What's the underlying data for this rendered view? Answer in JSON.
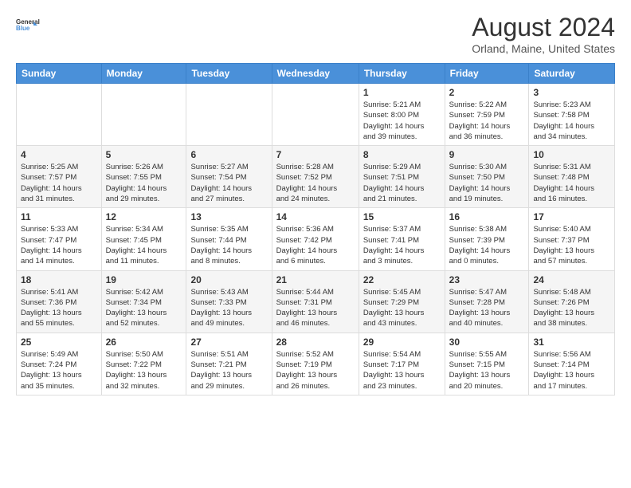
{
  "header": {
    "logo_line1": "General",
    "logo_line2": "Blue",
    "month_title": "August 2024",
    "location": "Orland, Maine, United States"
  },
  "weekdays": [
    "Sunday",
    "Monday",
    "Tuesday",
    "Wednesday",
    "Thursday",
    "Friday",
    "Saturday"
  ],
  "weeks": [
    [
      {
        "day": "",
        "info": ""
      },
      {
        "day": "",
        "info": ""
      },
      {
        "day": "",
        "info": ""
      },
      {
        "day": "",
        "info": ""
      },
      {
        "day": "1",
        "info": "Sunrise: 5:21 AM\nSunset: 8:00 PM\nDaylight: 14 hours\nand 39 minutes."
      },
      {
        "day": "2",
        "info": "Sunrise: 5:22 AM\nSunset: 7:59 PM\nDaylight: 14 hours\nand 36 minutes."
      },
      {
        "day": "3",
        "info": "Sunrise: 5:23 AM\nSunset: 7:58 PM\nDaylight: 14 hours\nand 34 minutes."
      }
    ],
    [
      {
        "day": "4",
        "info": "Sunrise: 5:25 AM\nSunset: 7:57 PM\nDaylight: 14 hours\nand 31 minutes."
      },
      {
        "day": "5",
        "info": "Sunrise: 5:26 AM\nSunset: 7:55 PM\nDaylight: 14 hours\nand 29 minutes."
      },
      {
        "day": "6",
        "info": "Sunrise: 5:27 AM\nSunset: 7:54 PM\nDaylight: 14 hours\nand 27 minutes."
      },
      {
        "day": "7",
        "info": "Sunrise: 5:28 AM\nSunset: 7:52 PM\nDaylight: 14 hours\nand 24 minutes."
      },
      {
        "day": "8",
        "info": "Sunrise: 5:29 AM\nSunset: 7:51 PM\nDaylight: 14 hours\nand 21 minutes."
      },
      {
        "day": "9",
        "info": "Sunrise: 5:30 AM\nSunset: 7:50 PM\nDaylight: 14 hours\nand 19 minutes."
      },
      {
        "day": "10",
        "info": "Sunrise: 5:31 AM\nSunset: 7:48 PM\nDaylight: 14 hours\nand 16 minutes."
      }
    ],
    [
      {
        "day": "11",
        "info": "Sunrise: 5:33 AM\nSunset: 7:47 PM\nDaylight: 14 hours\nand 14 minutes."
      },
      {
        "day": "12",
        "info": "Sunrise: 5:34 AM\nSunset: 7:45 PM\nDaylight: 14 hours\nand 11 minutes."
      },
      {
        "day": "13",
        "info": "Sunrise: 5:35 AM\nSunset: 7:44 PM\nDaylight: 14 hours\nand 8 minutes."
      },
      {
        "day": "14",
        "info": "Sunrise: 5:36 AM\nSunset: 7:42 PM\nDaylight: 14 hours\nand 6 minutes."
      },
      {
        "day": "15",
        "info": "Sunrise: 5:37 AM\nSunset: 7:41 PM\nDaylight: 14 hours\nand 3 minutes."
      },
      {
        "day": "16",
        "info": "Sunrise: 5:38 AM\nSunset: 7:39 PM\nDaylight: 14 hours\nand 0 minutes."
      },
      {
        "day": "17",
        "info": "Sunrise: 5:40 AM\nSunset: 7:37 PM\nDaylight: 13 hours\nand 57 minutes."
      }
    ],
    [
      {
        "day": "18",
        "info": "Sunrise: 5:41 AM\nSunset: 7:36 PM\nDaylight: 13 hours\nand 55 minutes."
      },
      {
        "day": "19",
        "info": "Sunrise: 5:42 AM\nSunset: 7:34 PM\nDaylight: 13 hours\nand 52 minutes."
      },
      {
        "day": "20",
        "info": "Sunrise: 5:43 AM\nSunset: 7:33 PM\nDaylight: 13 hours\nand 49 minutes."
      },
      {
        "day": "21",
        "info": "Sunrise: 5:44 AM\nSunset: 7:31 PM\nDaylight: 13 hours\nand 46 minutes."
      },
      {
        "day": "22",
        "info": "Sunrise: 5:45 AM\nSunset: 7:29 PM\nDaylight: 13 hours\nand 43 minutes."
      },
      {
        "day": "23",
        "info": "Sunrise: 5:47 AM\nSunset: 7:28 PM\nDaylight: 13 hours\nand 40 minutes."
      },
      {
        "day": "24",
        "info": "Sunrise: 5:48 AM\nSunset: 7:26 PM\nDaylight: 13 hours\nand 38 minutes."
      }
    ],
    [
      {
        "day": "25",
        "info": "Sunrise: 5:49 AM\nSunset: 7:24 PM\nDaylight: 13 hours\nand 35 minutes."
      },
      {
        "day": "26",
        "info": "Sunrise: 5:50 AM\nSunset: 7:22 PM\nDaylight: 13 hours\nand 32 minutes."
      },
      {
        "day": "27",
        "info": "Sunrise: 5:51 AM\nSunset: 7:21 PM\nDaylight: 13 hours\nand 29 minutes."
      },
      {
        "day": "28",
        "info": "Sunrise: 5:52 AM\nSunset: 7:19 PM\nDaylight: 13 hours\nand 26 minutes."
      },
      {
        "day": "29",
        "info": "Sunrise: 5:54 AM\nSunset: 7:17 PM\nDaylight: 13 hours\nand 23 minutes."
      },
      {
        "day": "30",
        "info": "Sunrise: 5:55 AM\nSunset: 7:15 PM\nDaylight: 13 hours\nand 20 minutes."
      },
      {
        "day": "31",
        "info": "Sunrise: 5:56 AM\nSunset: 7:14 PM\nDaylight: 13 hours\nand 17 minutes."
      }
    ]
  ]
}
